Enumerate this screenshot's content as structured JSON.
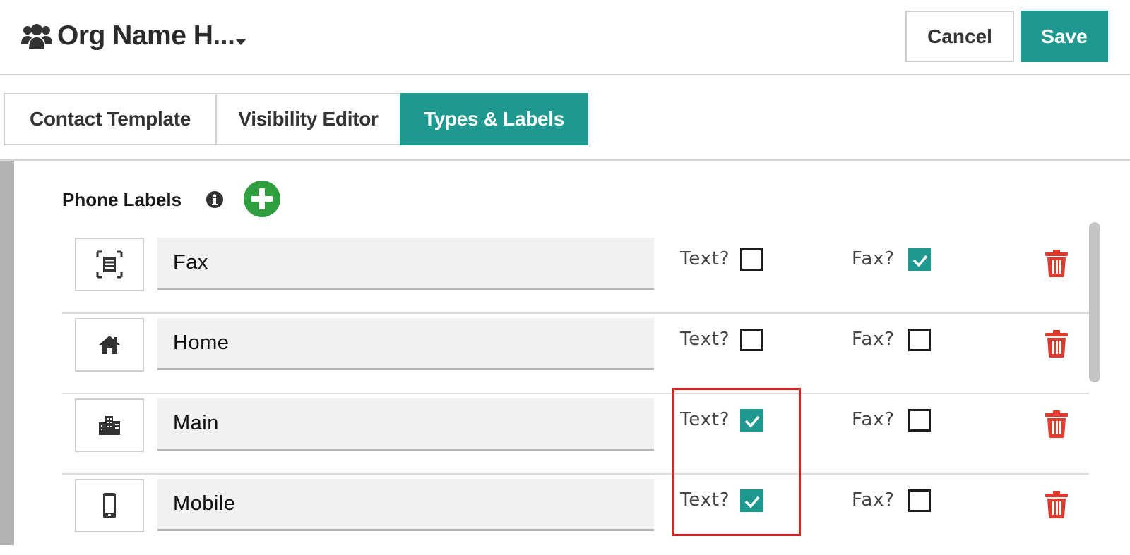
{
  "header": {
    "org_name": "Org Name H...",
    "org_icon": "users-icon",
    "cancel_label": "Cancel",
    "save_label": "Save"
  },
  "tabs": [
    {
      "label": "Contact Template",
      "active": false
    },
    {
      "label": "Visibility Editor",
      "active": false
    },
    {
      "label": "Types & Labels",
      "active": true
    }
  ],
  "section": {
    "title": "Phone Labels",
    "info_icon": "info-icon",
    "add_icon": "add-circle-icon"
  },
  "checkbox_labels": {
    "text": "Text?",
    "fax": "Fax?"
  },
  "rows": [
    {
      "icon": "fax-icon",
      "label": "Fax",
      "text": false,
      "fax": true
    },
    {
      "icon": "home-icon",
      "label": "Home",
      "text": false,
      "fax": false
    },
    {
      "icon": "building-icon",
      "label": "Main",
      "text": true,
      "fax": false
    },
    {
      "icon": "mobile-icon",
      "label": "Mobile",
      "text": true,
      "fax": false
    }
  ],
  "colors": {
    "accent": "#1f9990",
    "add": "#2e9e3f",
    "delete": "#e03a2e",
    "highlight": "#e02020"
  }
}
